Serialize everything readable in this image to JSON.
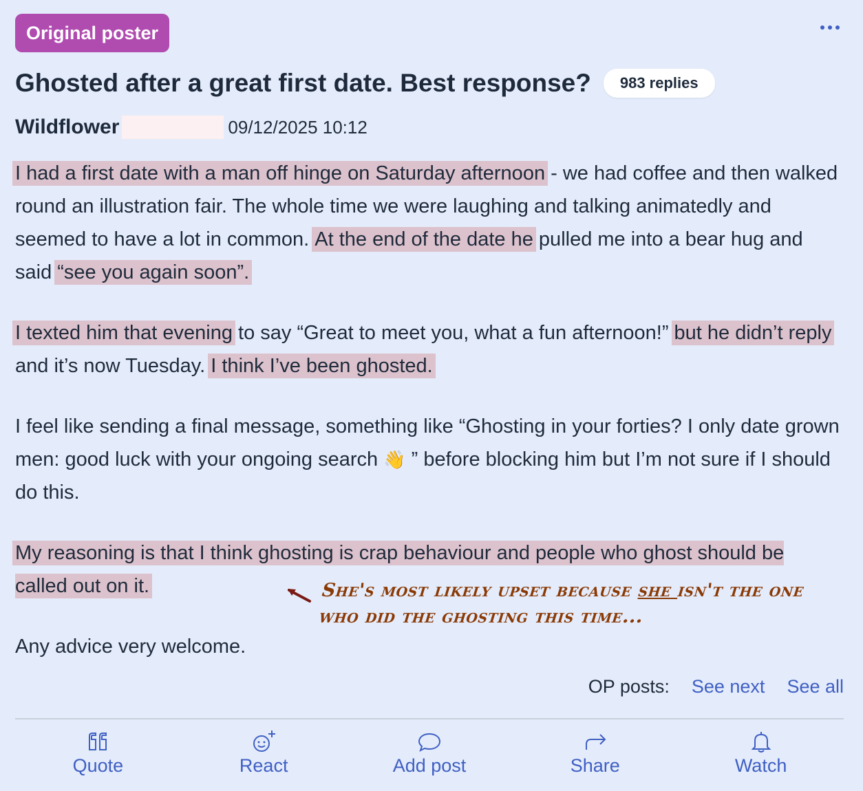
{
  "badge": "Original poster",
  "thread": {
    "title": "Ghosted after a great first date. Best response?",
    "replies": "983 replies"
  },
  "author": "Wildflower",
  "date": "09/12/2025 10:12",
  "post": {
    "p1": {
      "h1": "I had a first date with a man off hinge on Saturday afternoon",
      "t1": " - we had coffee and then walked round an illustration fair. The whole time we were laughing and talking animatedly and seemed to have a lot in common. ",
      "h2": "At the end of the date he",
      "t2": " pulled me into a bear hug and said ",
      "h3": "“see you again soon”."
    },
    "p2": {
      "h1": "I texted him that evening",
      "t1": " to say “Great to meet you, what a fun afternoon!” ",
      "h2": "but he didn’t reply",
      "t2": " and it’s now Tuesday. ",
      "h3": "I think I’ve been ghosted."
    },
    "p3": {
      "t1": "I feel like sending a final message, something like “Ghosting in your forties? I only date grown men: good luck with your ongoing search ",
      "emoji": "👋",
      "t2": " ” before blocking him but I’m not sure if I should do this."
    },
    "p4": {
      "h1": "My reasoning is that I think ghosting is crap behaviour and people who ghost should be called out on it."
    },
    "p5": "Any advice very welcome."
  },
  "annotation": {
    "a": "She's most likely upset because ",
    "u": "she ",
    "b": "isn't the one who did the ghosting this time..."
  },
  "op_posts": {
    "label": "OP posts:",
    "see_next": "See next",
    "see_all": "See all"
  },
  "actions": {
    "quote": "Quote",
    "react": "React",
    "add_post": "Add post",
    "share": "Share",
    "watch": "Watch"
  },
  "colors": {
    "background": "#e4ecfb",
    "badge": "#b04bb0",
    "highlight": "#dcc2cc",
    "link": "#3f5fc3",
    "annotation": "#8a3a06"
  }
}
